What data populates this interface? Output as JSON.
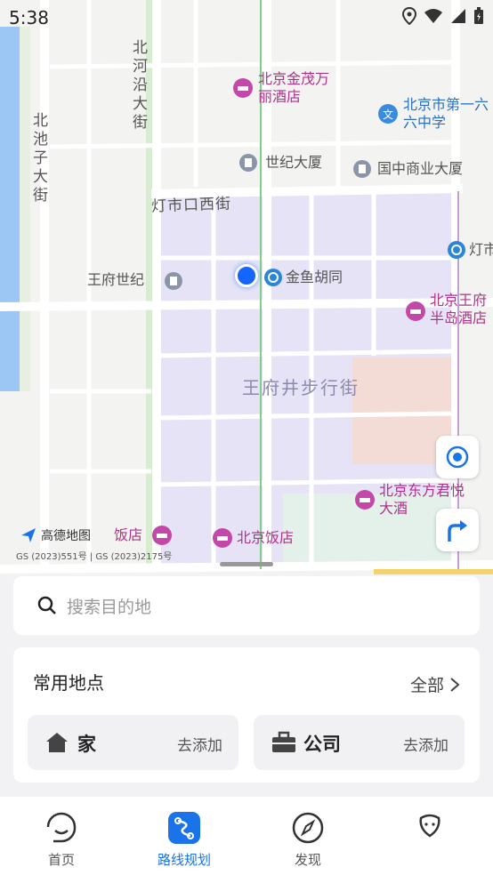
{
  "status_bar": {
    "time": "5:38"
  },
  "map": {
    "streets": {
      "beiheyan": "北河沿大街",
      "beichizi": "北池子大街",
      "dengshikou": "灯市口西街",
      "dengshi_partial": "灯市"
    },
    "district": "王府井步行街",
    "pois": {
      "jinmao": "北京金茂万丽酒店",
      "school166": "北京市第一六六中学",
      "century": "世纪大厦",
      "guozhong": "国中商业大厦",
      "wangfu_century": "王府世纪",
      "jinyu": "金鱼胡同",
      "peninsula": "北京王府半岛酒店",
      "oriental": "北京东方君悦大酒",
      "beijing_hotel": "北京饭店",
      "hotel_partial": "饭店"
    },
    "logo_text": "高德地图",
    "copyright": "GS (2023)551号 | GS (2023)2175号"
  },
  "search": {
    "placeholder": "搜索目的地"
  },
  "frequent_places": {
    "title": "常用地点",
    "all_label": "全部",
    "home": {
      "name": "家",
      "action": "去添加"
    },
    "company": {
      "name": "公司",
      "action": "去添加"
    }
  },
  "tabbar": {
    "tabs": [
      {
        "label": "首页"
      },
      {
        "label": "路线规划"
      },
      {
        "label": "发现"
      },
      {
        "label": ""
      }
    ],
    "active_color": "#1a73e8"
  }
}
